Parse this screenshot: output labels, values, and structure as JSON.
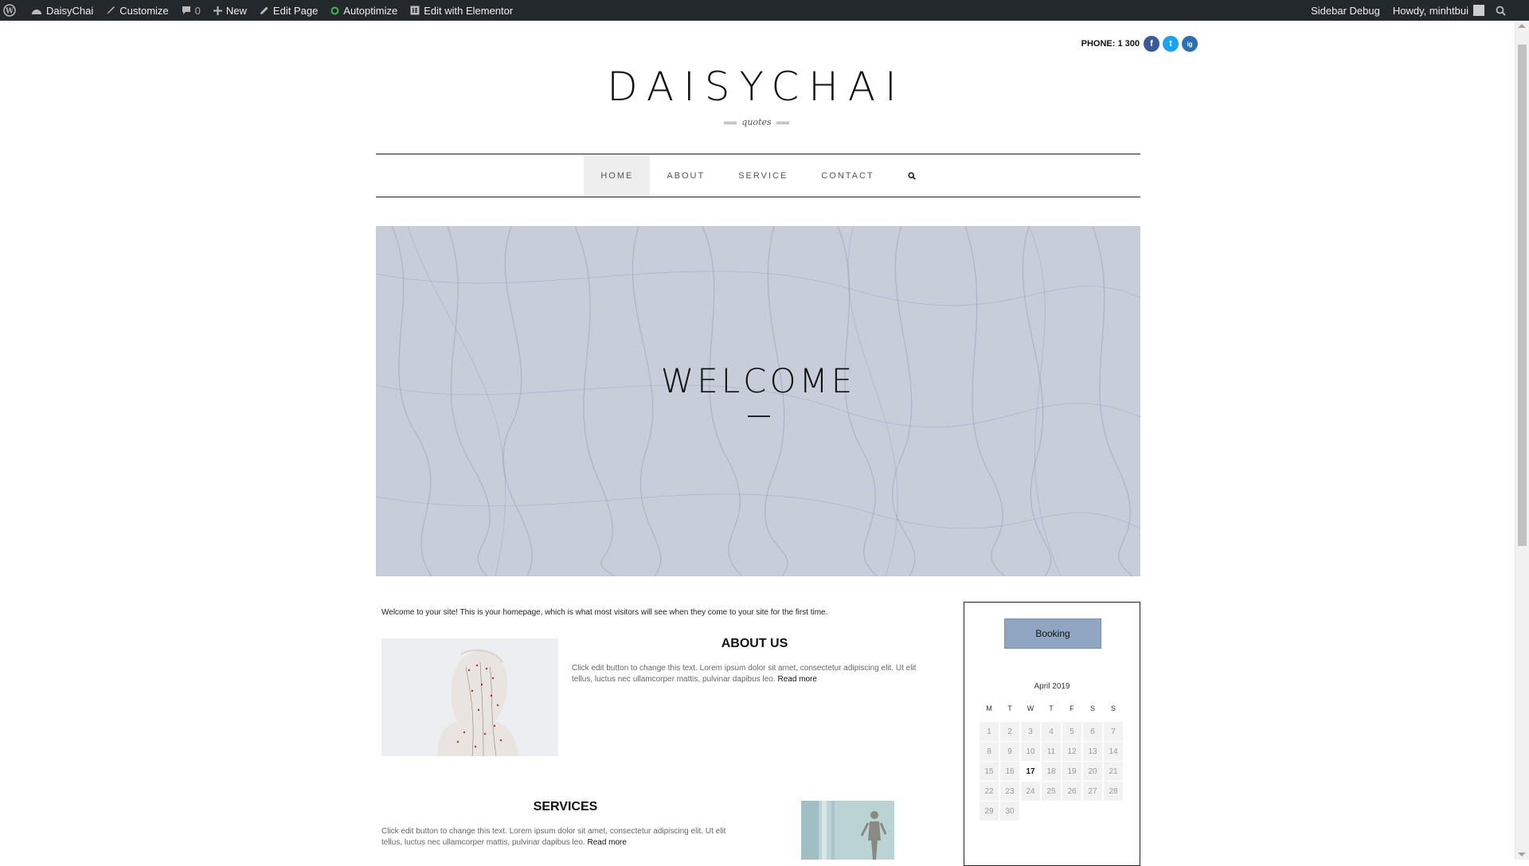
{
  "adminbar": {
    "site_name": "DaisyChai",
    "customize": "Customize",
    "comments_count": "0",
    "new": "New",
    "edit_page": "Edit Page",
    "autoptimize": "Autoptimize",
    "edit_elementor": "Edit with Elementor",
    "sidebar_debug": "Sidebar Debug",
    "howdy": "Howdy, minhtbui"
  },
  "header": {
    "phone": "PHONE: 1 300",
    "social": [
      "f",
      "t",
      "ig"
    ],
    "site_title": "DAISYCHAI",
    "tagline": "quotes"
  },
  "nav": {
    "items": [
      {
        "label": "HOME"
      },
      {
        "label": "ABOUT"
      },
      {
        "label": "SERVICE"
      },
      {
        "label": "CONTACT"
      }
    ]
  },
  "hero": {
    "title": "WELCOME"
  },
  "main": {
    "intro": "Welcome to your site! This is your homepage, which is what most visitors will see when they come to your site for the first time.",
    "about_title": "ABOUT US",
    "about_text": "Click edit button to change this text. Lorem ipsum dolor sit amet, consectetur adipiscing elit. Ut elit tellus, luctus nec ullamcorper mattis, pulvinar dapibus leo.",
    "read_more": "Read more",
    "services_title": "SERVICES",
    "services_text": "Click edit button to change this text. Lorem ipsum dolor sit amet, consectetur adipiscing elit. Ut elit tellus, luctus nec ullamcorper mattis, pulvinar dapibus leo."
  },
  "sidebar": {
    "booking": "Booking",
    "calendar": {
      "caption": "April 2019",
      "weekdays": [
        "M",
        "T",
        "W",
        "T",
        "F",
        "S",
        "S"
      ],
      "days": [
        "1",
        "2",
        "3",
        "4",
        "5",
        "6",
        "7",
        "8",
        "9",
        "10",
        "11",
        "12",
        "13",
        "14",
        "15",
        "16",
        "17",
        "18",
        "19",
        "20",
        "21",
        "22",
        "23",
        "24",
        "25",
        "26",
        "27",
        "28",
        "29",
        "30"
      ],
      "today": "17"
    }
  },
  "colors": {
    "adminbar_bg": "#23282d",
    "booking_bg": "#8fa5c1",
    "hero_bg": "#c5cdd8",
    "facebook": "#3b5998",
    "twitter": "#1da1f2",
    "instagram": "#2a6fb0"
  }
}
